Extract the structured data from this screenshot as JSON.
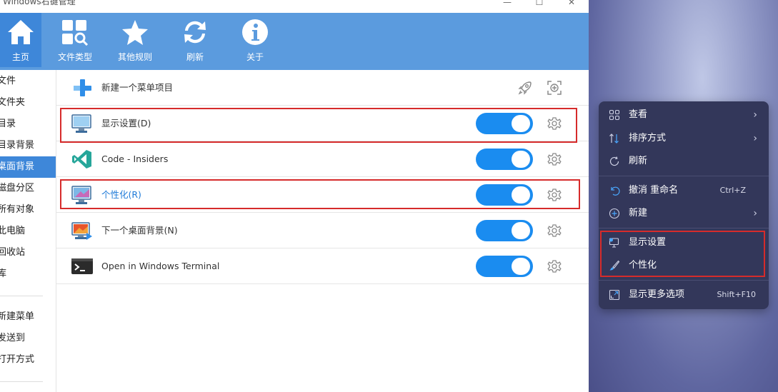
{
  "window": {
    "title": "Windows右键管理",
    "controls": {
      "minimize": "—",
      "maximize": "☐",
      "close": "✕"
    }
  },
  "toolbar": [
    {
      "label": "主页",
      "icon": "home-icon",
      "active": true
    },
    {
      "label": "文件类型",
      "icon": "file-types-icon",
      "active": false
    },
    {
      "label": "其他规则",
      "icon": "star-icon",
      "active": false
    },
    {
      "label": "刷新",
      "icon": "refresh-icon",
      "active": false
    },
    {
      "label": "关于",
      "icon": "info-icon",
      "active": false
    }
  ],
  "sidebar": {
    "items": [
      {
        "label": "文件",
        "active": false
      },
      {
        "label": "文件夹",
        "active": false
      },
      {
        "label": "目录",
        "active": false
      },
      {
        "label": "目录背景",
        "active": false
      },
      {
        "label": "桌面背景",
        "active": true
      },
      {
        "label": "磁盘分区",
        "active": false
      },
      {
        "label": "所有对象",
        "active": false
      },
      {
        "label": "此电脑",
        "active": false
      },
      {
        "label": "回收站",
        "active": false
      },
      {
        "label": "库",
        "active": false
      }
    ],
    "items2": [
      {
        "label": "新建菜单"
      },
      {
        "label": "发送到"
      },
      {
        "label": "打开方式"
      }
    ]
  },
  "main": {
    "new_item_label": "新建一个菜单项目",
    "rows": [
      {
        "label": "显示设置(D)",
        "icon": "display-settings-icon",
        "enabled": true,
        "highlighted": true,
        "blue": false
      },
      {
        "label": "Code - Insiders",
        "icon": "vscode-insiders-icon",
        "enabled": true,
        "highlighted": false,
        "blue": false
      },
      {
        "label": "个性化(R)",
        "icon": "personalize-icon",
        "enabled": true,
        "highlighted": true,
        "blue": true
      },
      {
        "label": "下一个桌面背景(N)",
        "icon": "next-background-icon",
        "enabled": true,
        "highlighted": false,
        "blue": false
      },
      {
        "label": "Open in Windows Terminal",
        "icon": "terminal-icon",
        "enabled": true,
        "highlighted": false,
        "blue": false
      }
    ]
  },
  "context_menu": {
    "groups": [
      [
        {
          "label": "查看",
          "icon": "grid-view-icon",
          "submenu": true,
          "shortcut": ""
        },
        {
          "label": "排序方式",
          "icon": "sort-icon",
          "submenu": true,
          "shortcut": ""
        },
        {
          "label": "刷新",
          "icon": "refresh-icon",
          "submenu": false,
          "shortcut": ""
        }
      ],
      [
        {
          "label": "撤消 重命名",
          "icon": "undo-icon",
          "submenu": false,
          "shortcut": "Ctrl+Z"
        },
        {
          "label": "新建",
          "icon": "new-plus-icon",
          "submenu": true,
          "shortcut": ""
        }
      ],
      [
        {
          "label": "显示设置",
          "icon": "display-settings-icon",
          "submenu": false,
          "shortcut": ""
        },
        {
          "label": "个性化",
          "icon": "brush-icon",
          "submenu": false,
          "shortcut": ""
        }
      ],
      [
        {
          "label": "显示更多选项",
          "icon": "more-options-icon",
          "submenu": false,
          "shortcut": "Shift+F10"
        }
      ]
    ],
    "submenu_arrow": "›"
  },
  "colors": {
    "toolbar_bg": "#5b9bde",
    "active_bg": "#3e87d9",
    "toggle_on": "#1a8cf0",
    "highlight_border": "#d62b2b",
    "menu_bg": "#33375a"
  }
}
